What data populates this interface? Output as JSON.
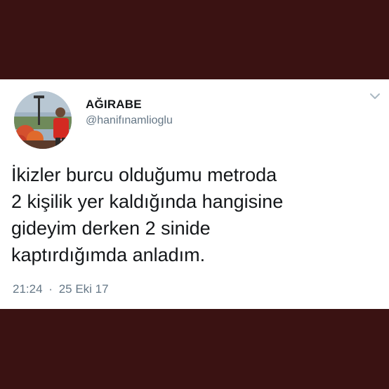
{
  "tweet": {
    "display_name": "AĞIRABE",
    "handle": "@hanifınamlioglu",
    "text_lines": [
      "İkizler burcu olduğumu metroda",
      "2 kişilik yer kaldığında hangisine",
      "gideyim derken 2 sinide",
      "kaptırdığımda anladım."
    ],
    "time": "21:24",
    "separator": "·",
    "date": "25 Eki 17",
    "icons": {
      "avatar": "profile-photo",
      "menu": "chevron-down-icon"
    }
  },
  "colors": {
    "background": "#3a1212",
    "card": "#ffffff",
    "text": "#14171a",
    "muted": "#657786"
  }
}
